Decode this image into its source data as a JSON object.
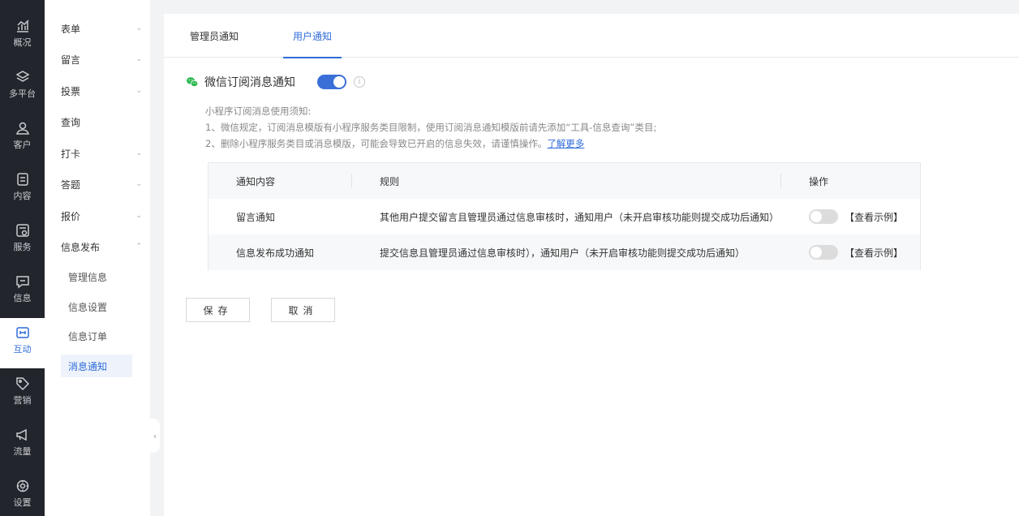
{
  "rail": {
    "items": [
      {
        "label": "概况",
        "icon": "chart-icon"
      },
      {
        "label": "多平台",
        "icon": "layers-icon"
      },
      {
        "label": "客户",
        "icon": "user-icon"
      },
      {
        "label": "内容",
        "icon": "document-icon"
      },
      {
        "label": "服务",
        "icon": "service-icon"
      },
      {
        "label": "信息",
        "icon": "message-icon"
      },
      {
        "label": "互动",
        "icon": "interact-icon"
      },
      {
        "label": "营销",
        "icon": "tag-icon"
      },
      {
        "label": "流量",
        "icon": "megaphone-icon"
      },
      {
        "label": "设置",
        "icon": "settings-icon"
      }
    ],
    "active": "互动"
  },
  "subnav": {
    "items": [
      {
        "label": "表单"
      },
      {
        "label": "留言"
      },
      {
        "label": "投票"
      },
      {
        "label": "查询"
      },
      {
        "label": "打卡"
      },
      {
        "label": "答题"
      },
      {
        "label": "报价"
      },
      {
        "label": "信息发布"
      }
    ],
    "children": [
      {
        "label": "管理信息"
      },
      {
        "label": "信息设置"
      },
      {
        "label": "信息订单"
      },
      {
        "label": "消息通知"
      }
    ],
    "active_child": "消息通知"
  },
  "tabs": {
    "admin": "管理员通知",
    "user": "用户通知",
    "active": "用户通知"
  },
  "wechat": {
    "title": "微信订阅消息通知",
    "enabled": true
  },
  "notes": {
    "heading": "小程序订阅消息使用须知:",
    "line1": "1、微信规定，订阅消息模版有小程序服务类目限制，使用订阅消息通知模版前请先添加“工具-信息查询”类目;",
    "line2": "2、删除小程序服务类目或消息模版，可能会导致已开启的信息失效，请谨慎操作。",
    "link": "了解更多"
  },
  "table": {
    "headers": {
      "content": "通知内容",
      "rule": "规则",
      "action": "操作"
    },
    "rows": [
      {
        "content": "留言通知",
        "rule": "其他用户提交留言且管理员通过信息审核时，通知用户（未开启审核功能则提交成功后通知）",
        "enabled": false,
        "view": "【查看示例】"
      },
      {
        "content": "信息发布成功通知",
        "rule": "提交信息且管理员通过信息审核时），通知用户（未开启审核功能则提交成功后通知）",
        "enabled": false,
        "view": "【查看示例】"
      }
    ]
  },
  "buttons": {
    "save": "保存",
    "cancel": "取消"
  },
  "colors": {
    "accent": "#2f6bd8",
    "rail_bg": "#22252b",
    "wechat_green": "#2bb84d"
  }
}
